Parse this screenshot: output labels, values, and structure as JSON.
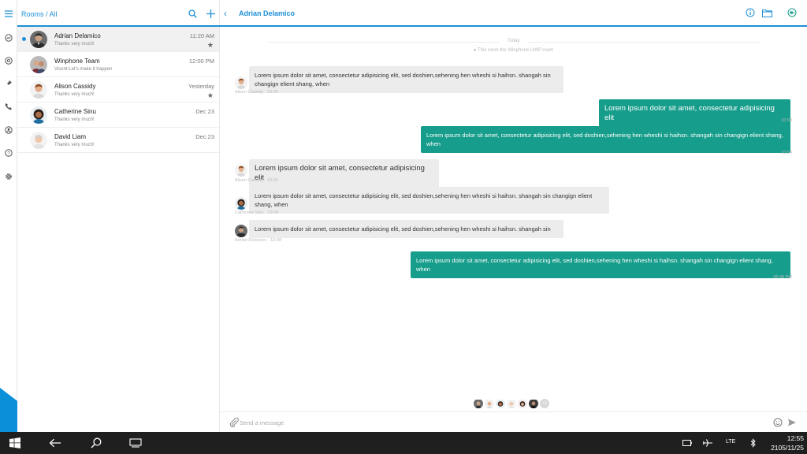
{
  "sidebar": {
    "icons": [
      "menu-icon",
      "rooms-icon",
      "mentions-icon",
      "pin-icon",
      "phone-icon",
      "contacts-icon",
      "help-icon",
      "settings-icon"
    ]
  },
  "rooms_panel": {
    "title": "Rooms / All",
    "rooms": [
      {
        "name": "Adrian Delamico",
        "preview": "Thanks very much!",
        "time": "11:20 AM",
        "unread": true,
        "starred": true
      },
      {
        "name": "Winphone Team",
        "preview": "Vicent:Let's make it happen",
        "time": "12:00 PM",
        "unread": false,
        "starred": false
      },
      {
        "name": "Alison Cassidy",
        "preview": "Thanks very much!",
        "time": "Yesterday",
        "unread": false,
        "starred": true
      },
      {
        "name": "Catherine Sinu",
        "preview": "Thanks very much!",
        "time": "Dec 23",
        "unread": false,
        "starred": false
      },
      {
        "name": "David Liam",
        "preview": "Thanks very much!",
        "time": "Dec 23",
        "unread": false,
        "starred": false
      }
    ]
  },
  "chat": {
    "title": "Adrian Delamico",
    "day_label": "Today",
    "system_message": "This room the Winphone UWP room",
    "messages": [
      {
        "dir": "in",
        "text": "Lorem ipsum dolor sit amet, consectetur adipisicing elit, sed doshien,sehening hen wheshi si haihsn. shangah sin changign elient shang, when",
        "meta": "Alison Cassidy · 10:00"
      },
      {
        "dir": "out",
        "text": "Lorem ipsum dolor sit amet, consectetur adipisicing elit",
        "meta": "10:03"
      },
      {
        "dir": "out",
        "text": "Lorem ipsum dolor sit amet, consectetur adipisicing elit, sed doshien,sehening hen wheshi si haihsn. shangah sin changign elient shang, when",
        "meta": "10:04"
      },
      {
        "dir": "in",
        "text": "Lorem ipsum dolor sit amet, consectetur adipisicing elit",
        "meta": "Alison Cassidy · 10:04"
      },
      {
        "dir": "in",
        "text": "Lorem ipsum dolor sit amet, consectetur adipisicing elit, sed doshien,sehening hen wheshi si haihsn. shangah sin changign elient shang, when",
        "meta": "Catherine Sinu · 10:04"
      },
      {
        "dir": "in",
        "text": "Lorem ipsum dolor sit amet, consectetur adipisicing elit, sed doshien,sehening hen wheshi si haihsn. shangah sin",
        "meta": "Adrian Delamico · 10:08"
      },
      {
        "dir": "out",
        "text": "Lorem ipsum dolor sit amet, consectetur adipisicing elit, sed doshien,sehening hen wheshi si haihsn. shangah sin changign elient shang, when",
        "meta": "02:45 PM"
      }
    ],
    "read_more_count": "+3",
    "composer_placeholder": "Send a message"
  },
  "taskbar": {
    "lte_label": "LTE",
    "time": "12:55",
    "date": "2105/11/25"
  },
  "colors": {
    "accent": "#1f8fd6",
    "outgoing_bubble": "#169d8b",
    "incoming_bubble": "#ececec",
    "taskbar": "#1f1f1f"
  }
}
